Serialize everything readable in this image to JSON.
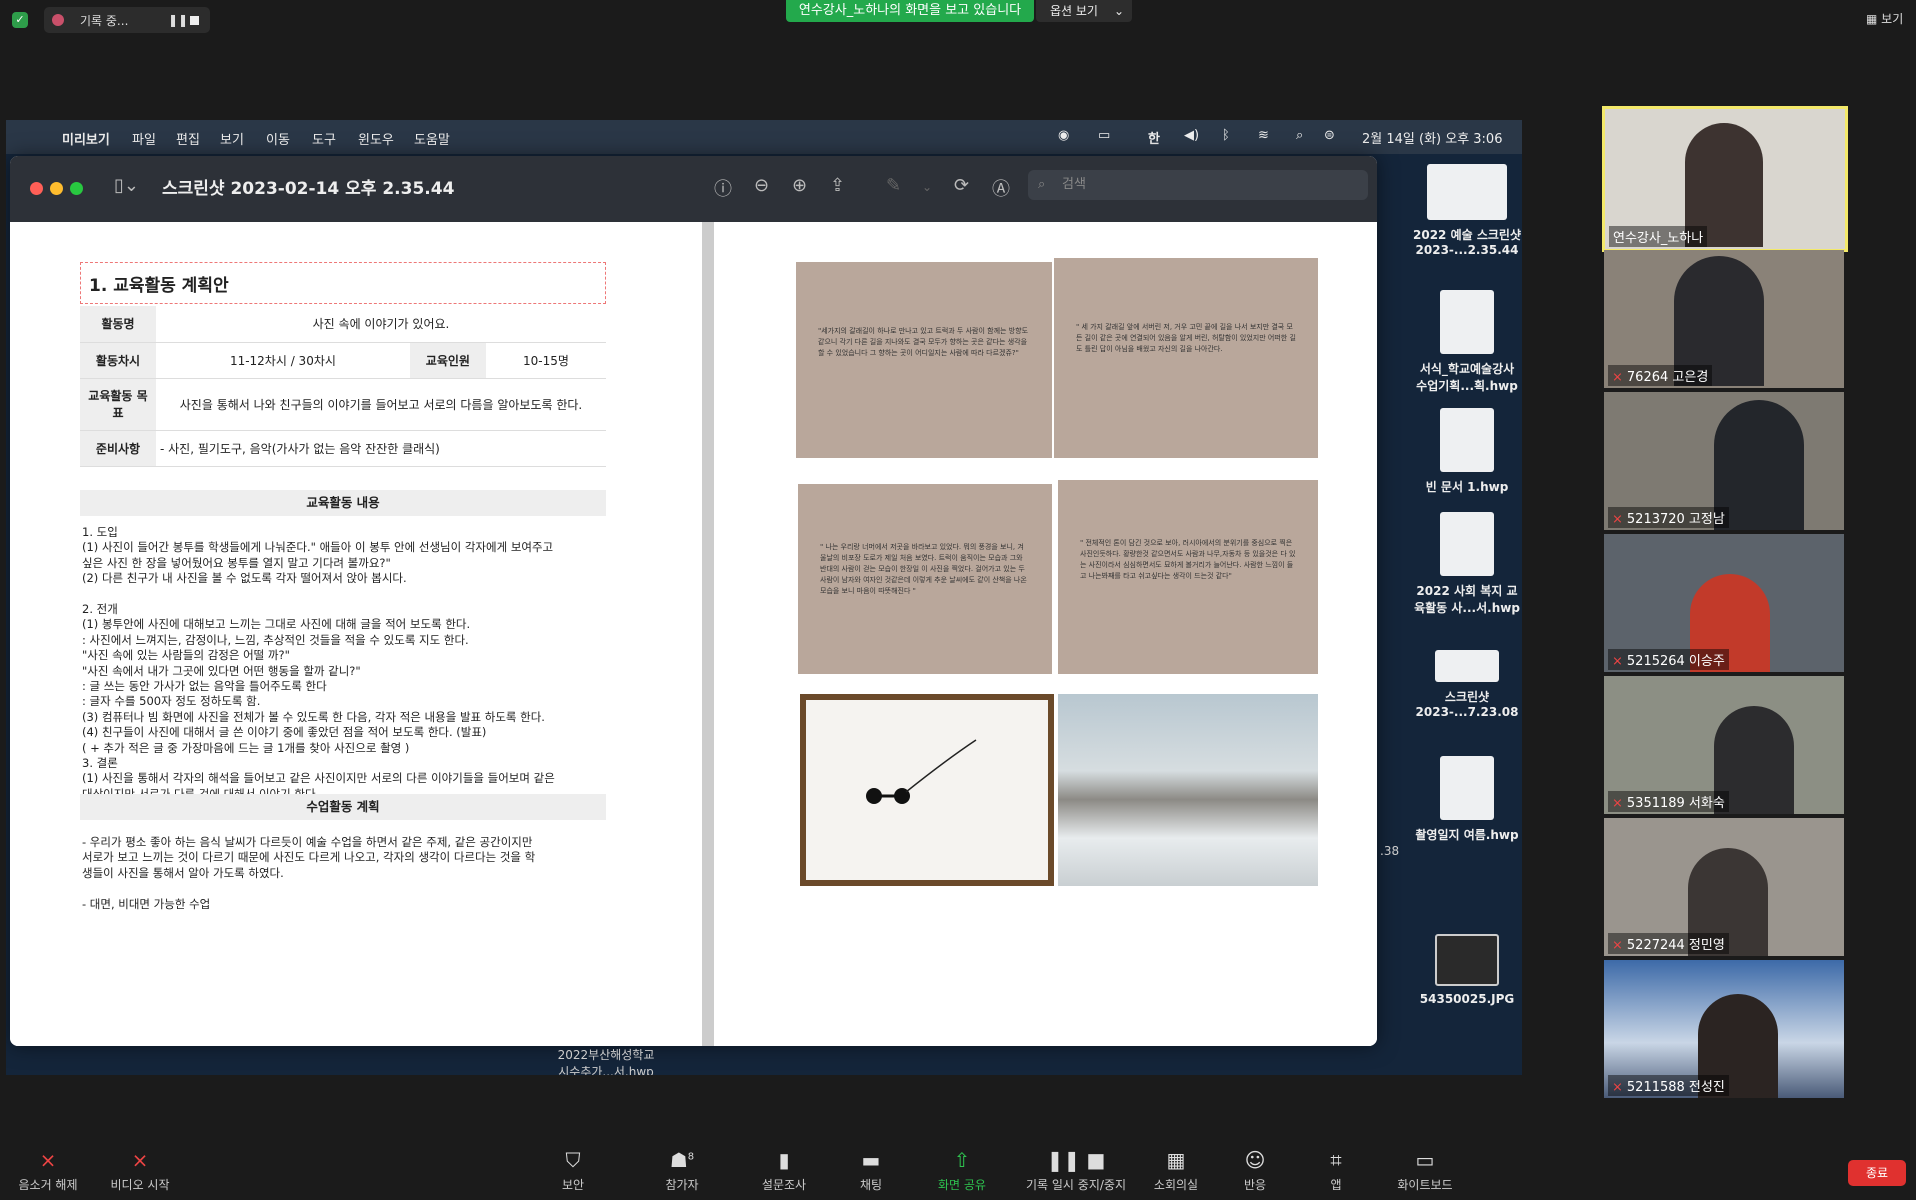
{
  "top_bar": {
    "recording_label": "기록 중...",
    "pause_icon": "pause-icon",
    "stop_icon": "stop-icon",
    "share_banner": "연수강사_노하나의 화면을 보고 있습니다",
    "view_options": "옵션 보기",
    "view_button": "보기"
  },
  "mac_menubar": {
    "app": "미리보기",
    "menus": [
      "파일",
      "편집",
      "보기",
      "이동",
      "도구",
      "윈도우",
      "도움말"
    ],
    "clock": "2월 14일 (화) 오후 3:06",
    "input_method": "한"
  },
  "preview_window": {
    "title": "스크린샷 2023-02-14 오후 2.35.44",
    "search_placeholder": "검색"
  },
  "document_left": {
    "section_title": "1.  교육활동 계획안",
    "rows": [
      {
        "label": "활동명",
        "value": "사진 속에 이야기가 있어요."
      },
      {
        "label": "활동차시",
        "value": "11-12차시 / 30차시",
        "label2": "교육인원",
        "value2": "10-15명"
      },
      {
        "label": "교육활동 목표",
        "value": "사진을 통해서 나와 친구들의 이야기를 들어보고 서로의 다름을 알아보도록 한다."
      },
      {
        "label": "준비사항",
        "value": "- 사진, 필기도구, 음악(가사가 없는 음악 잔잔한 클래식)"
      }
    ],
    "content_header": "교육활동 내용",
    "content_lines": [
      "1. 도입",
      "(1) 사진이 들어간 봉투를 학생들에게 나눠준다.\" 애들아 이 봉투 안에 선생님이 각자에게 보여주고",
      "     싶은 사진 한 장을 넣어뒀어요 봉투를 열지 말고 기다려 볼까요?\"",
      "(2) 다른 친구가 내 사진을 볼 수 없도록 각자 떨어져서 앉아 봅시다.",
      "",
      "2. 전개",
      "(1) 봉투안에 사진에 대해보고 느끼는 그대로 사진에 대해 글을 적어 보도록 한다.",
      "    : 사진에서 느껴지는, 감정이나, 느낌, 추상적인 것들을 적을 수 있도록 지도 한다.",
      "    \"사진 속에 있는 사람들의 감정은 어떨 까?\"",
      "    \"사진 속에서 내가 그곳에 있다면 어떤 행동을 할까 같니?\"",
      "    : 글 쓰는 동안 가사가 없는 음악을 틀어주도록 한다",
      "    : 글자 수를 500자 정도 정하도록 함.",
      "(3) 컴퓨터나 빔 화면에 사진을 전체가 볼 수 있도록 한 다음, 각자 적은 내용을 발표 하도록 한다.",
      "(4) 친구들이 사진에 대해서 글 쓴 이야기 중에 좋았던 점을 적어 보도록 한다. (발표)",
      "( + 추가 적은 글 중 가장마음에 드는 글 1개를 찾아 사진으로 촬영 )",
      "3. 결론",
      "(1) 사진을 통해서 각자의 해석을 들어보고 같은 사진이지만 서로의 다른 이야기들을 들어보며 같은",
      "     대상이지만 서로가 다른 것에 대해서 이야기 한다."
    ],
    "plan_header": "수업활동 계획",
    "plan_lines": [
      "- 우리가 평소 좋아 하는 음식 날씨가 다르듯이 예술 수업을 하면서 같은 주제, 같은 공간이지만",
      "  서로가 보고 느끼는 것이 다르기 때문에 사진도 다르게 나오고, 각자의 생각이 다르다는 것을 학",
      "  생들이 사진을 통해서 알아 가도록 하였다.",
      "",
      "- 대면, 비대면 가능한 수업"
    ]
  },
  "document_right": {
    "photo_texts": [
      "\"세가지의 갈래길이 하나로 만나고 있고 트럭과 두 사람이 함께는 방향도 같으니 각기 다른 길을 지나와도 결국 모두가 향하는 곳은 같다는 생각을 할 수 있었습니다 그 향하는 곳이 어디일지는 사람에 따라 다르겠쥬?\"",
      "\" 세 가지 갈래길 앞에 서버린 저, 거우 고민 끝에 길을 나서 보지만 결국 모든 길이 같은 곳에 연결되어 있음을 알게 버린, 허탈함이 있었지만 어떠한 길도 틀린 답이 아님을 배웠고 자신의 길을 나아간다.",
      "\" 나는 우리랑 너머에서 저곳을 바라보고 있었다. 뭐의 풍경을 보니, 겨울날의 비포장 도로가 제일 처음 보였다. 트럭이 움직이는 모습과 그와 반대의 사람이 걷는 모습이 한장일 이 사진을 찍었다. 걸어가고 있는 두사람이 남자와 여자인 것같은데 이렇게 추운 날씨에도 같이 산책을 나온 모습을 보니 마음이 따뜻해진다 \"",
      "\" 전체적인 톤이 담긴 것으로 보아, 러시아에서의 분위기를 중심으로 찍은 사진인듯하다. 황량한것 같으면서도 사람과 나무,자동차 등 있을것은 다 있는 사진이라서 심심하면서도 묘하게 볼거리가 늘어난다. 사람한 느낌이 들고 나는봐째를 타고 쉬고싶다는 생각이 드는것 같다\""
    ]
  },
  "desktop_icons": [
    {
      "label": "2022 예술 스크린샷\n2023-...2.35.44"
    },
    {
      "label": "서식_학교예술강사\n수업기획...획.hwp"
    },
    {
      "label": "빈 문서 1.hwp"
    },
    {
      "label": "2022 사회 복지 교\n육활동 사...서.hwp"
    },
    {
      "label": "스크린샷\n2023-...7.23.08"
    },
    {
      "label": "촬영일지 여름.hwp"
    },
    {
      "label": "54350025.JPG"
    }
  ],
  "desktop_bottom_label": "2022부산해성학교\n시수추가...서.hwp",
  "desktop_side_label": ".38",
  "participants": [
    {
      "name": "연수강사_노하나",
      "muted": false
    },
    {
      "name": "76264 고은경",
      "muted": true
    },
    {
      "name": "5213720 고정남",
      "muted": true
    },
    {
      "name": "5215264 이승주",
      "muted": true
    },
    {
      "name": "5351189 서화숙",
      "muted": true
    },
    {
      "name": "5227244 정민영",
      "muted": true
    },
    {
      "name": "5211588 전성진",
      "muted": true
    }
  ],
  "bottom_bar": {
    "unmute": "음소거 해제",
    "start_video": "비디오 시작",
    "security": "보안",
    "participants": "참가자",
    "participants_count": "8",
    "polls": "설문조사",
    "chat": "채팅",
    "share_screen": "화면 공유",
    "pause_stop_recording": "기록 일시 중지/중지",
    "breakout_rooms": "소회의실",
    "reactions": "반응",
    "apps": "앱",
    "whiteboard": "화이트보드",
    "end": "종료"
  },
  "colors": {
    "share_green": "#23a94c",
    "end_red": "#e0312f",
    "active_speaker": "#f3e96a"
  }
}
